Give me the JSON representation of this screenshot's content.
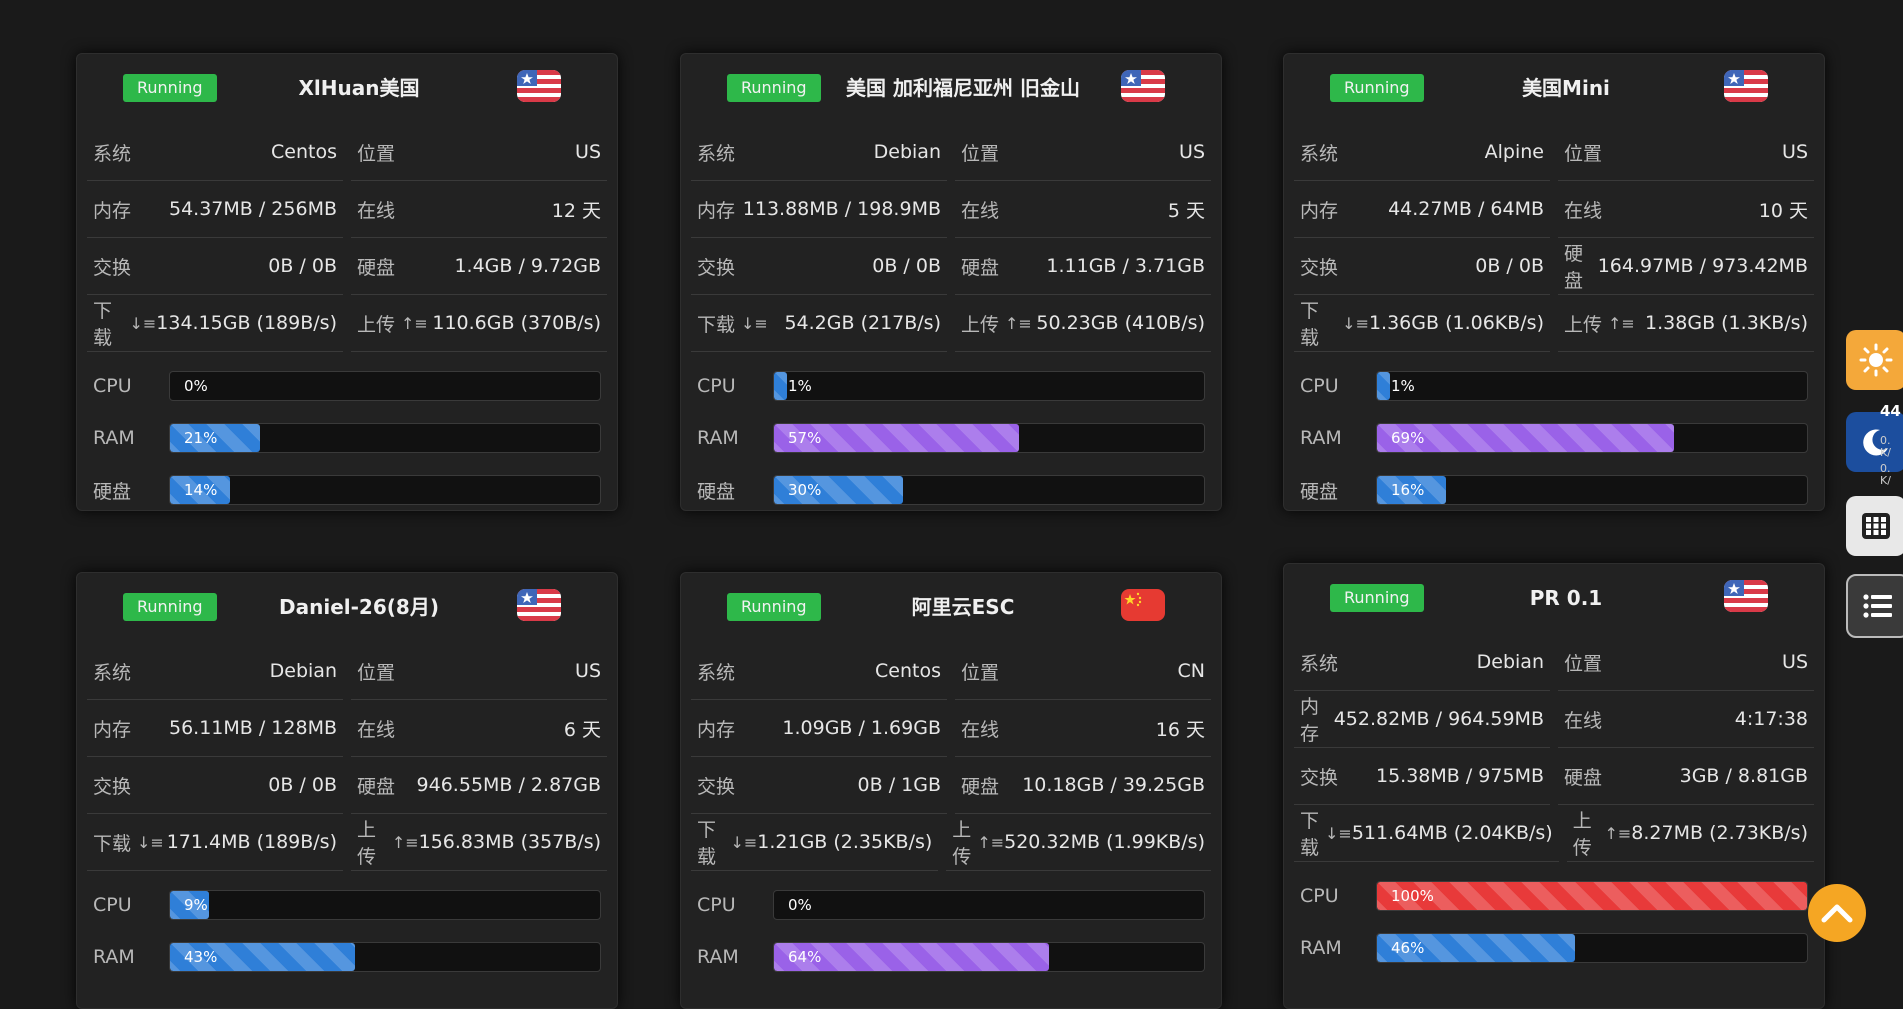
{
  "ui": {
    "lbl_system": "系统",
    "lbl_location": "位置",
    "lbl_memory": "内存",
    "lbl_online": "在线",
    "lbl_swap": "交换",
    "lbl_disk": "硬盘",
    "lbl_download": "下载",
    "lbl_upload": "上传",
    "bar_cpu": "CPU",
    "bar_ram": "RAM",
    "bar_disk": "硬盘",
    "side_status_text": "44",
    "side_rate_1": "0.",
    "side_rate_unit_1": "K/",
    "side_rate_2": "0.",
    "side_rate_unit_2": "K/"
  },
  "colors": {
    "running": "#2eb84a",
    "bar_blue": "#2f7fd8",
    "bar_purple": "#9a62e8",
    "bar_red": "#e83a3a",
    "accent_orange": "#f5a623"
  },
  "servers": [
    {
      "status": "Running",
      "name": "XlHuan美国",
      "flag": "us-flag",
      "system": "Centos",
      "location": "US",
      "memory": "54.37MB / 256MB",
      "online": "12 天",
      "swap": "0B / 0B",
      "disk": "1.4GB / 9.72GB",
      "download": "134.15GB (189B/s)",
      "upload": "110.6GB (370B/s)",
      "cpu": {
        "text": "0%",
        "value": 0,
        "color": "blue"
      },
      "ram": {
        "text": "21%",
        "value": 21,
        "color": "blue"
      },
      "diskbar": {
        "text": "14%",
        "value": 14,
        "color": "blue"
      }
    },
    {
      "status": "Running",
      "name": "美国 加利福尼亚州 旧金山",
      "flag": "us-flag",
      "system": "Debian",
      "location": "US",
      "memory": "113.88MB / 198.9MB",
      "online": "5 天",
      "swap": "0B / 0B",
      "disk": "1.11GB / 3.71GB",
      "download": "54.2GB (217B/s)",
      "upload": "50.23GB (410B/s)",
      "cpu": {
        "text": "1%",
        "value": 1,
        "color": "blue"
      },
      "ram": {
        "text": "57%",
        "value": 57,
        "color": "purple"
      },
      "diskbar": {
        "text": "30%",
        "value": 30,
        "color": "blue"
      }
    },
    {
      "status": "Running",
      "name": "美国Mini",
      "flag": "us-flag",
      "system": "Alpine",
      "location": "US",
      "memory": "44.27MB / 64MB",
      "online": "10 天",
      "swap": "0B / 0B",
      "disk": "164.97MB / 973.42MB",
      "download": "1.36GB (1.06KB/s)",
      "upload": "1.38GB (1.3KB/s)",
      "cpu": {
        "text": "1%",
        "value": 1,
        "color": "blue"
      },
      "ram": {
        "text": "69%",
        "value": 69,
        "color": "purple"
      },
      "diskbar": {
        "text": "16%",
        "value": 16,
        "color": "blue"
      }
    },
    {
      "status": "Running",
      "name": "Daniel-26(8月)",
      "flag": "us-flag",
      "system": "Debian",
      "location": "US",
      "memory": "56.11MB / 128MB",
      "online": "6 天",
      "swap": "0B / 0B",
      "disk": "946.55MB / 2.87GB",
      "download": "171.4MB (189B/s)",
      "upload": "156.83MB (357B/s)",
      "cpu": {
        "text": "9%",
        "value": 9,
        "color": "blue"
      },
      "ram": {
        "text": "43%",
        "value": 43,
        "color": "blue"
      }
    },
    {
      "status": "Running",
      "name": "阿里云ESC",
      "flag": "cn-flag",
      "system": "Centos",
      "location": "CN",
      "memory": "1.09GB / 1.69GB",
      "online": "16 天",
      "swap": "0B / 1GB",
      "disk": "10.18GB / 39.25GB",
      "download": "1.21GB (2.35KB/s)",
      "upload": "520.32MB (1.99KB/s)",
      "cpu": {
        "text": "0%",
        "value": 0,
        "color": "blue"
      },
      "ram": {
        "text": "64%",
        "value": 64,
        "color": "purple"
      }
    },
    {
      "status": "Running",
      "name": "PR 0.1",
      "flag": "us-flag",
      "system": "Debian",
      "location": "US",
      "memory": "452.82MB / 964.59MB",
      "online": "4:17:38",
      "swap": "15.38MB / 975MB",
      "disk": "3GB / 8.81GB",
      "download": "511.64MB (2.04KB/s)",
      "upload": "8.27MB (2.73KB/s)",
      "cpu": {
        "text": "100%",
        "value": 100,
        "color": "red"
      },
      "ram": {
        "text": "46%",
        "value": 46,
        "color": "blue"
      }
    }
  ]
}
